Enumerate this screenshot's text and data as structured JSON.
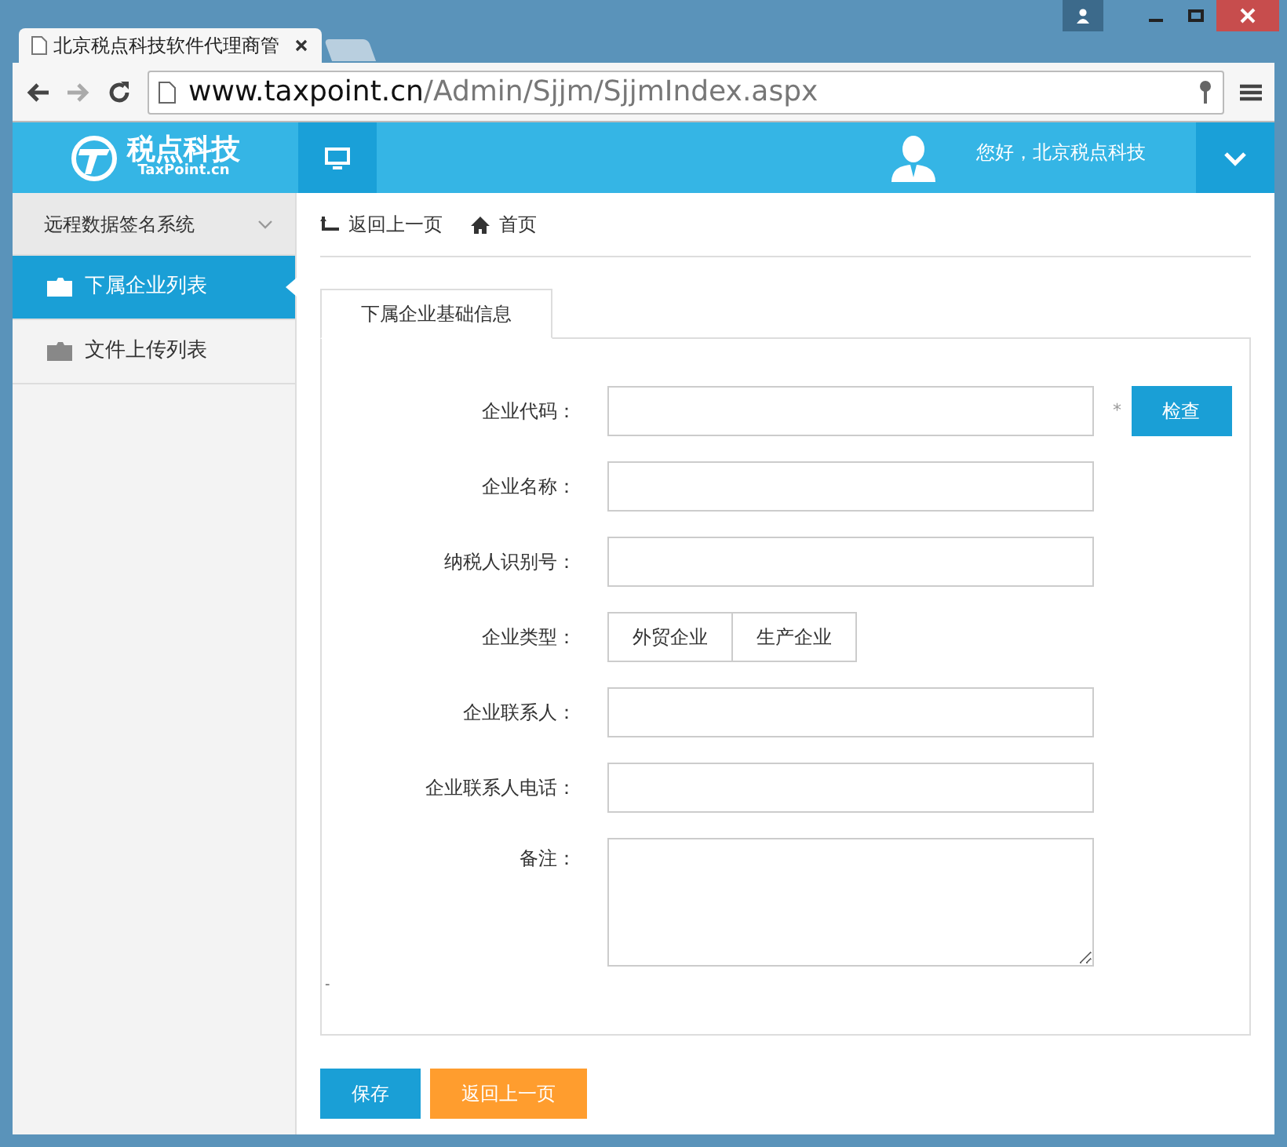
{
  "browser": {
    "tab_title": "北京税点科技软件代理商管",
    "url_host": "www.taxpoint.cn",
    "url_path": "/Admin/Sjjm/SjjmIndex.aspx"
  },
  "header": {
    "logo_name": "税点科技",
    "logo_domain": "TaxPoint.cn",
    "greeting": "您好，北京税点科技"
  },
  "sidebar": {
    "group": "远程数据签名系统",
    "expanded": true,
    "items": [
      {
        "label": "下属企业列表",
        "selected": true
      },
      {
        "label": "文件上传列表",
        "selected": false
      }
    ]
  },
  "breadcrumb": {
    "back": "返回上一页",
    "home": "首页"
  },
  "tabs": [
    {
      "label": "下属企业基础信息",
      "selected": true
    }
  ],
  "form": [
    {
      "kind": "text",
      "label": "企业代码：",
      "required_mark": "*",
      "button": "检查"
    },
    {
      "kind": "text",
      "label": "企业名称："
    },
    {
      "kind": "text",
      "label": "纳税人识别号："
    },
    {
      "kind": "toggle",
      "label": "企业类型：",
      "options": [
        {
          "label": "外贸企业",
          "selected": false
        },
        {
          "label": "生产企业",
          "selected": false
        }
      ]
    },
    {
      "kind": "text",
      "label": "企业联系人："
    },
    {
      "kind": "text",
      "label": "企业联系人电话："
    },
    {
      "kind": "textarea",
      "label": "备注："
    }
  ],
  "stray_mark": "-",
  "buttons": [
    {
      "label": "保存",
      "kind": "primary"
    },
    {
      "label": "返回上一页",
      "kind": "secondary"
    }
  ]
}
